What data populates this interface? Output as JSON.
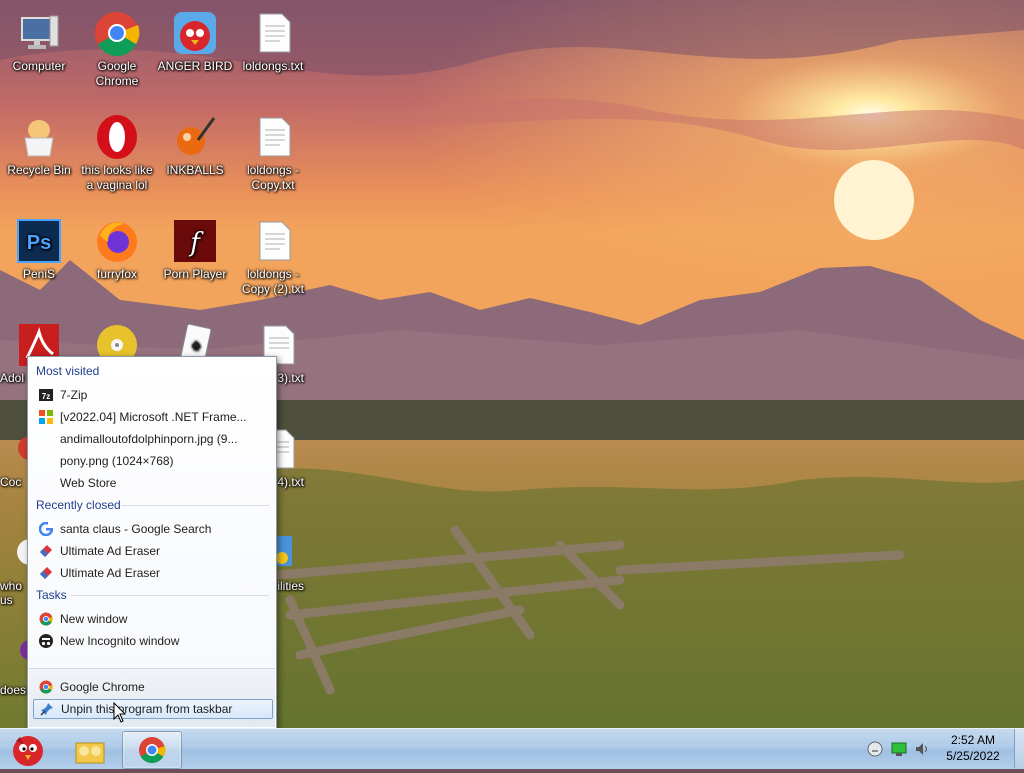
{
  "desktop": {
    "icons": [
      {
        "label": "Computer",
        "icon": "computer-icon"
      },
      {
        "label": "Google Chrome",
        "icon": "chrome-icon"
      },
      {
        "label": "ANGER BIRD",
        "icon": "angry-bird-icon"
      },
      {
        "label": "loldongs.txt",
        "icon": "text-file-icon"
      },
      {
        "label": "Recycle Bin",
        "icon": "recycle-bin-icon"
      },
      {
        "label": "this looks like a vagina lol",
        "icon": "opera-icon"
      },
      {
        "label": "INKBALLS",
        "icon": "inkballs-icon"
      },
      {
        "label": "loldongs - Copy.txt",
        "icon": "text-file-icon"
      },
      {
        "label": "PeniS",
        "icon": "photoshop-icon"
      },
      {
        "label": "furryfox",
        "icon": "firefox-icon"
      },
      {
        "label": "Porn Player",
        "icon": "flash-icon"
      },
      {
        "label": "loldongs - Copy (2).txt",
        "icon": "text-file-icon"
      },
      {
        "label": "Adol",
        "icon": "adobe-reader-icon"
      },
      {
        "label": "",
        "icon": "disc-icon"
      },
      {
        "label": "",
        "icon": "solitaire-icon"
      },
      {
        "label": "ngs - 3).txt",
        "icon": "text-file-icon"
      },
      {
        "label": "Coc",
        "icon": "app-icon"
      },
      {
        "label": "ngs - 4).txt",
        "icon": "text-file-icon"
      },
      {
        "label": "who us",
        "icon": "app-icon"
      },
      {
        "label": "ilities",
        "icon": "folder-icon"
      },
      {
        "label": "does",
        "icon": "app-icon"
      }
    ]
  },
  "jumplist": {
    "most_visited_header": "Most visited",
    "most_visited": [
      {
        "label": "7-Zip",
        "icon": "7zip-icon"
      },
      {
        "label": "[v2022.04] Microsoft .NET Frame...",
        "icon": "windows-icon"
      },
      {
        "label": "andimalloutofdolphinporn.jpg (9...",
        "icon": "blank-icon"
      },
      {
        "label": "pony.png (1024×768)",
        "icon": "blank-icon"
      },
      {
        "label": "Web Store",
        "icon": "blank-icon"
      }
    ],
    "recently_closed_header": "Recently closed",
    "recently_closed": [
      {
        "label": "santa claus - Google Search",
        "icon": "google-icon"
      },
      {
        "label": "Ultimate Ad Eraser",
        "icon": "ad-eraser-icon"
      },
      {
        "label": "Ultimate Ad Eraser",
        "icon": "ad-eraser-icon"
      }
    ],
    "tasks_header": "Tasks",
    "tasks": [
      {
        "label": "New window",
        "icon": "chrome-icon"
      },
      {
        "label": "New Incognito window",
        "icon": "incognito-icon"
      }
    ],
    "app_label": "Google Chrome",
    "unpin_label": "Unpin this program from taskbar"
  },
  "taskbar": {
    "clock_time": "2:52 AM",
    "clock_date": "5/25/2022"
  }
}
